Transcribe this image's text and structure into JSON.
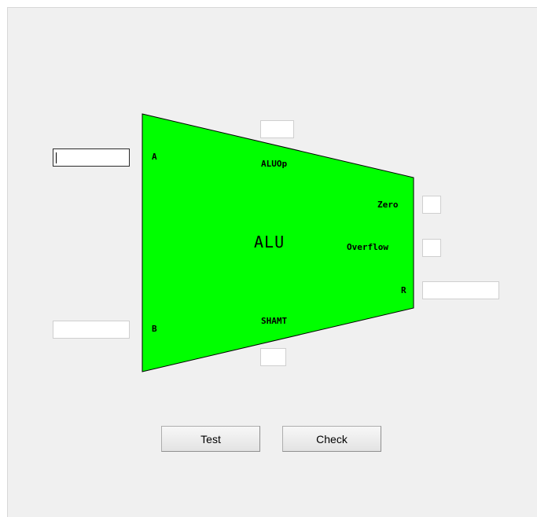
{
  "alu": {
    "title": "ALU",
    "fill_color": "#00ff00",
    "labels": {
      "a": "A",
      "b": "B",
      "aluop": "ALUOp",
      "shamt": "SHAMT",
      "zero": "Zero",
      "overflow": "Overflow",
      "r": "R"
    }
  },
  "inputs": {
    "a_value": "",
    "b_value": "",
    "aluop_value": "",
    "shamt_value": ""
  },
  "outputs": {
    "zero_value": "",
    "overflow_value": "",
    "r_value": ""
  },
  "buttons": {
    "test_label": "Test",
    "check_label": "Check"
  }
}
